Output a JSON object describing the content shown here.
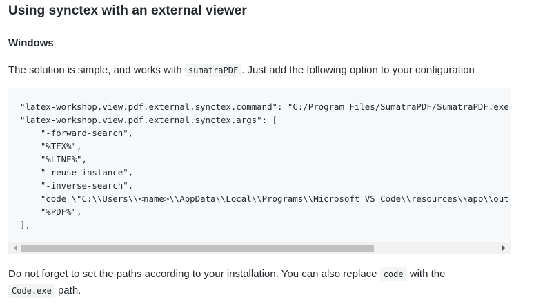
{
  "heading": "Using synctex with an external viewer",
  "subheading": "Windows",
  "intro": {
    "before": "The solution is simple, and works with ",
    "code": "sumatraPDF",
    "after": ". Just add the following option to your configuration"
  },
  "code_lines": [
    "\"latex-workshop.view.pdf.external.synctex.command\": \"C:/Program Files/SumatraPDF/SumatraPDF.exe",
    "\"latex-workshop.view.pdf.external.synctex.args\": [",
    "    \"-forward-search\",",
    "    \"%TEX%\",",
    "    \"%LINE%\",",
    "    \"-reuse-instance\",",
    "    \"-inverse-search\",",
    "    \"code \\\"C:\\\\Users\\\\<name>\\\\AppData\\\\Local\\\\Programs\\\\Microsoft VS Code\\\\resources\\\\app\\\\out",
    "    \"%PDF%\",",
    "],"
  ],
  "scrollbar": {
    "thumb_fraction": 0.74,
    "position_fraction": 0.0
  },
  "outro": {
    "text1": "Do not forget to set the paths according to your installation. You can also replace ",
    "code1": "code",
    "text2": " with the",
    "code2": "Code.exe",
    "text3": " path."
  },
  "colors": {
    "text": "#24292e",
    "code_bg": "#f6f8fa",
    "inline_code_bg": "#f3f4f4",
    "scroll_thumb": "#c1c1c1"
  }
}
